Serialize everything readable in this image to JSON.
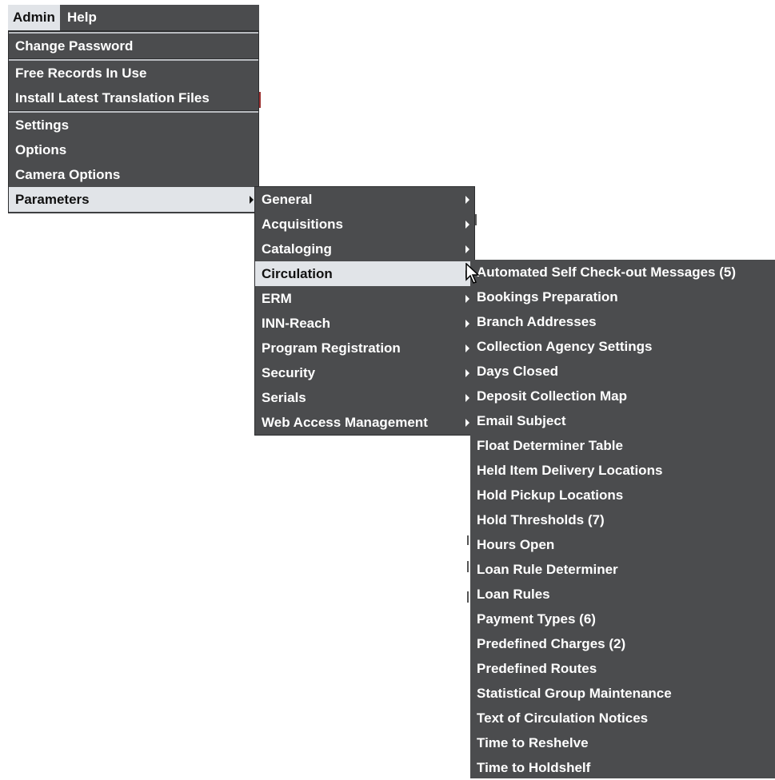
{
  "menubar": {
    "admin_label": "Admin",
    "help_label": "Help"
  },
  "admin_menu": {
    "change_password": "Change Password",
    "free_records": "Free Records In Use",
    "install_translation": "Install Latest Translation Files",
    "settings": "Settings",
    "options": "Options",
    "camera_options": "Camera Options",
    "parameters": "Parameters"
  },
  "parameters_menu": {
    "general": "General",
    "acquisitions": "Acquisitions",
    "cataloging": "Cataloging",
    "circulation": "Circulation",
    "erm": "ERM",
    "inn_reach": "INN-Reach",
    "program_registration": "Program Registration",
    "security": "Security",
    "serials": "Serials",
    "web_access": "Web Access Management"
  },
  "circulation_menu": {
    "items": [
      "Automated Self Check-out Messages (5)",
      "Bookings Preparation",
      "Branch Addresses",
      "Collection Agency Settings",
      "Days Closed",
      "Deposit Collection Map",
      "Email Subject",
      "Float Determiner Table",
      "Held Item Delivery Locations",
      "Hold Pickup Locations",
      "Hold Thresholds (7)",
      "Hours Open",
      "Loan Rule Determiner",
      "Loan Rules",
      "Payment Types (6)",
      "Predefined Charges (2)",
      "Predefined Routes",
      "Statistical Group Maintenance",
      "Text of Circulation Notices",
      "Time to Reshelve",
      "Time to Holdshelf"
    ]
  },
  "colors": {
    "menu_bg": "#4b4c4e",
    "highlight_bg": "#e1e4e8",
    "text": "#ffffff"
  },
  "icons": {
    "submenu": "triangle-right",
    "cursor": "mouse-pointer"
  }
}
